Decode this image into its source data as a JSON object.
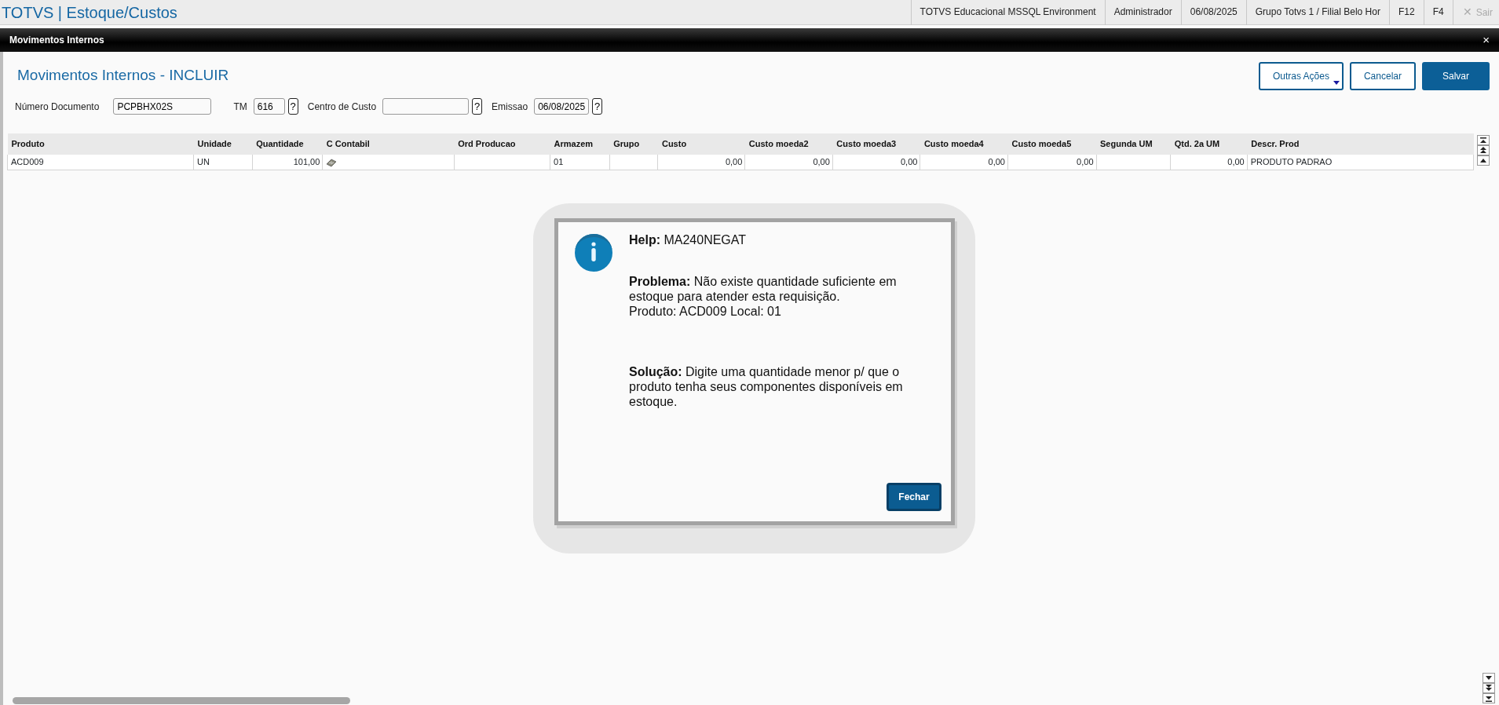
{
  "app_bar": {
    "title": "TOTVS | Estoque/Custos",
    "items": [
      "TOTVS Educacional MSSQL Environment",
      "Administrador",
      "06/08/2025",
      "Grupo Totvs 1 / Filial Belo Hor",
      "F12",
      "F4"
    ],
    "exit": {
      "icon": "✕",
      "label": "Sair",
      "disabled": true
    }
  },
  "window": {
    "title": "Movimentos Internos",
    "close": "×"
  },
  "page_title": "Movimentos Internos - INCLUIR",
  "actions": [
    {
      "label": "Outras Ações",
      "kind": "dropdown"
    },
    {
      "label": "Cancelar",
      "kind": "outline"
    },
    {
      "label": "Salvar",
      "kind": "primary"
    }
  ],
  "fields": [
    {
      "label": "Número Documento",
      "value": "PCPBHX02S"
    },
    {
      "label": "TM",
      "value": "616",
      "help": "?"
    },
    {
      "label": "Centro de Custo",
      "help": "?"
    },
    {
      "label": "Emissao",
      "value": "06/08/2025",
      "help": "?"
    }
  ],
  "table": {
    "columns": [
      "Produto",
      "Unidade",
      "Quantidade",
      "C Contabil",
      "Ord Producao",
      "Armazem",
      "Grupo",
      "Custo",
      "Custo moeda2",
      "Custo moeda3",
      "Custo moeda4",
      "Custo moeda5",
      "Segunda UM",
      "Qtd. 2a UM",
      "Descr. Prod"
    ],
    "rows": [
      {
        "cells": [
          "ACD009",
          "UN",
          "101,00",
          null,
          null,
          "01",
          null,
          "0,00",
          "0,00",
          "0,00",
          "0,00",
          "0,00",
          null,
          "0,00",
          "PRODUTO PADRAO"
        ]
      }
    ]
  },
  "dialog": {
    "help": "**Help:** MA240NEGAT",
    "problem": "**Problema:** Não existe quantidade suficiente em estoque para atender esta requisição.",
    "problem_detail": "Produto: ACD009 Local: 01",
    "solution": "**Solução:** Digite uma quantidade menor p/ que o produto tenha seus componentes disponíveis em estoque.",
    "button": "Fechar"
  }
}
